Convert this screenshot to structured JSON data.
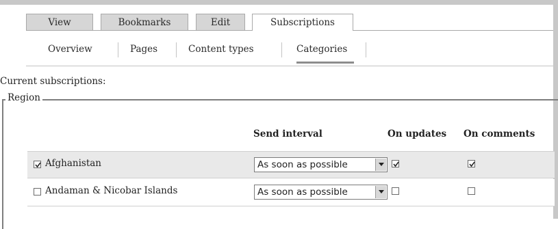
{
  "tabs": [
    {
      "label": "View",
      "active": false
    },
    {
      "label": "Bookmarks",
      "active": false
    },
    {
      "label": "Edit",
      "active": false
    },
    {
      "label": "Subscriptions",
      "active": true
    }
  ],
  "subnav": [
    {
      "label": "Overview"
    },
    {
      "label": "Pages"
    },
    {
      "label": "Content types"
    },
    {
      "label": "Categories",
      "active": true
    }
  ],
  "current_label": "Current subscriptions:",
  "fieldset": {
    "legend": "Region",
    "columns": {
      "send_interval": "Send interval",
      "on_updates": "On updates",
      "on_comments": "On comments"
    },
    "rows": [
      {
        "name": "Afghanistan",
        "selected": true,
        "interval": "As soon as possible",
        "on_updates": true,
        "on_comments": true
      },
      {
        "name": "Andaman & Nicobar Islands",
        "selected": false,
        "interval": "As soon as possible",
        "on_updates": false,
        "on_comments": false
      }
    ]
  },
  "icons": {
    "checkmark": "checkmark-icon",
    "dropdown": "chevron-down-icon"
  }
}
